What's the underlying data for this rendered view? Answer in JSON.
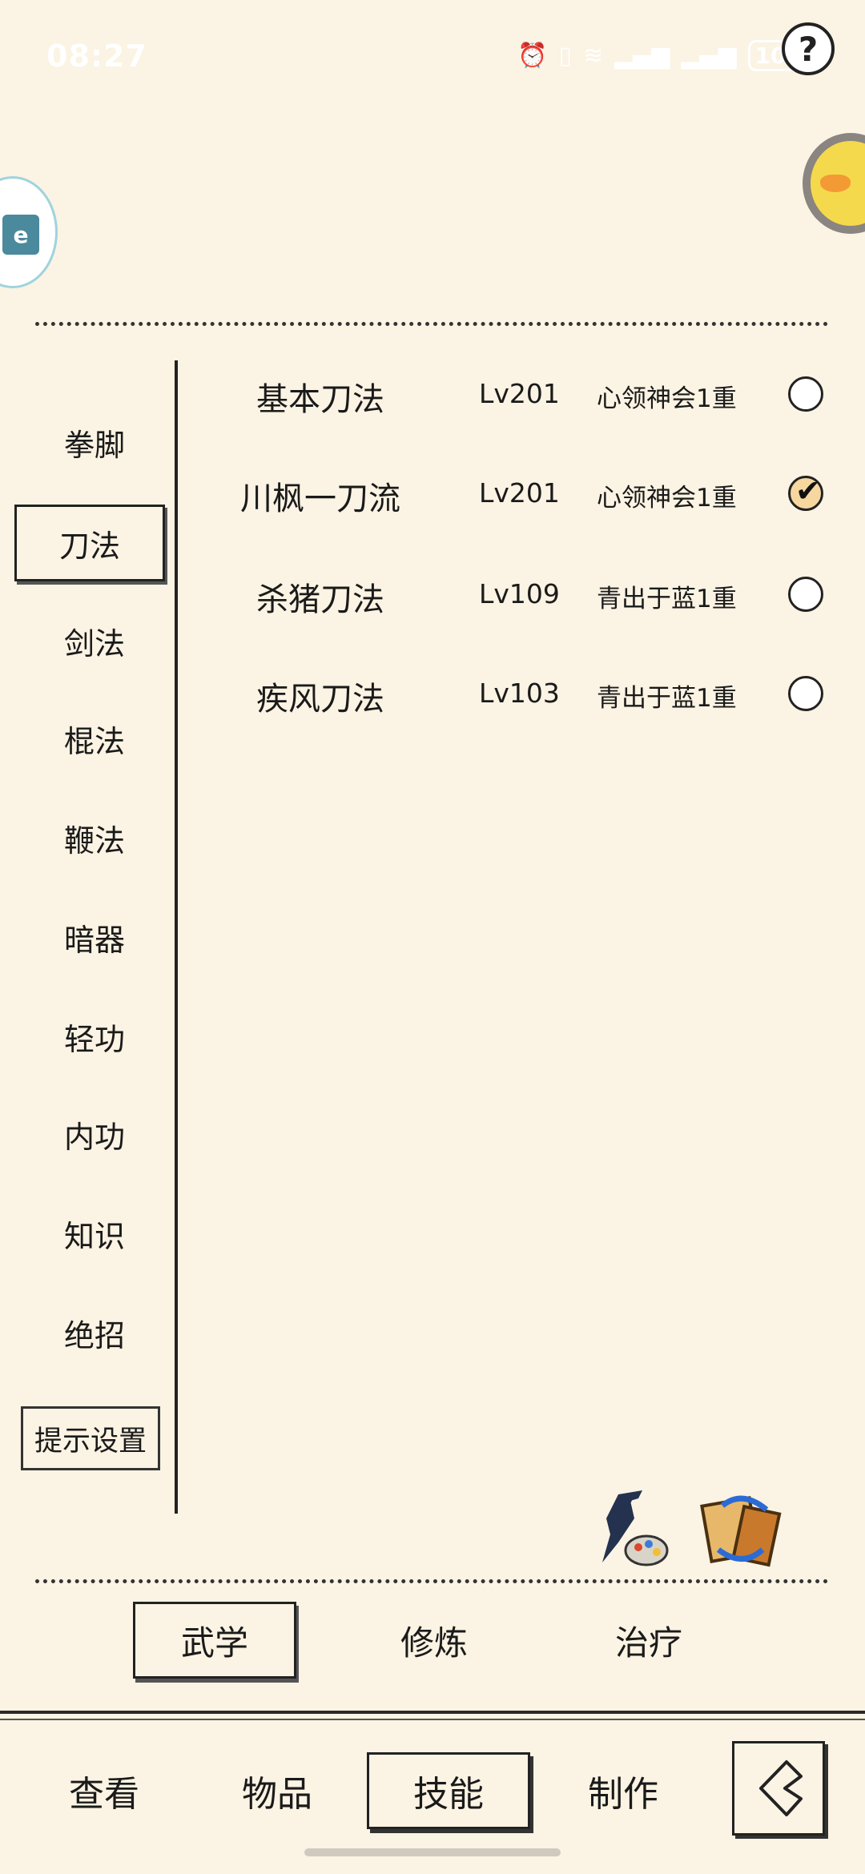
{
  "status_bar": {
    "time": "08:27",
    "battery": "100",
    "icons": [
      "alarm-icon",
      "vibrate-icon",
      "wifi-icon",
      "signal-5g-icon",
      "signal-5g-icon"
    ]
  },
  "help": {
    "label": "?"
  },
  "floating": {
    "left_icon": "app-icon",
    "right_icon": "duck-avatar-icon"
  },
  "categories": [
    {
      "label": "拳脚",
      "active": false
    },
    {
      "label": "刀法",
      "active": true
    },
    {
      "label": "剑法",
      "active": false
    },
    {
      "label": "棍法",
      "active": false
    },
    {
      "label": "鞭法",
      "active": false
    },
    {
      "label": "暗器",
      "active": false
    },
    {
      "label": "轻功",
      "active": false
    },
    {
      "label": "内功",
      "active": false
    },
    {
      "label": "知识",
      "active": false
    },
    {
      "label": "绝招",
      "active": false
    }
  ],
  "tips_button": "提示设置",
  "skills": [
    {
      "name": "基本刀法",
      "level": "Lv201",
      "tier": "心领神会1重",
      "selected": false
    },
    {
      "name": "川枫一刀流",
      "level": "Lv201",
      "tier": "心领神会1重",
      "selected": true
    },
    {
      "name": "杀猪刀法",
      "level": "Lv109",
      "tier": "青出于蓝1重",
      "selected": false
    },
    {
      "name": "疾风刀法",
      "level": "Lv103",
      "tier": "青出于蓝1重",
      "selected": false
    }
  ],
  "action_icons": [
    "martial-artist-palette-icon",
    "book-refresh-icon"
  ],
  "sub_tabs": [
    {
      "label": "武学",
      "active": true
    },
    {
      "label": "修炼",
      "active": false
    },
    {
      "label": "治疗",
      "active": false
    }
  ],
  "nav_tabs": [
    {
      "label": "查看",
      "active": false
    },
    {
      "label": "物品",
      "active": false
    },
    {
      "label": "技能",
      "active": true
    },
    {
      "label": "制作",
      "active": false
    }
  ],
  "back_icon": "back-arrow-icon"
}
